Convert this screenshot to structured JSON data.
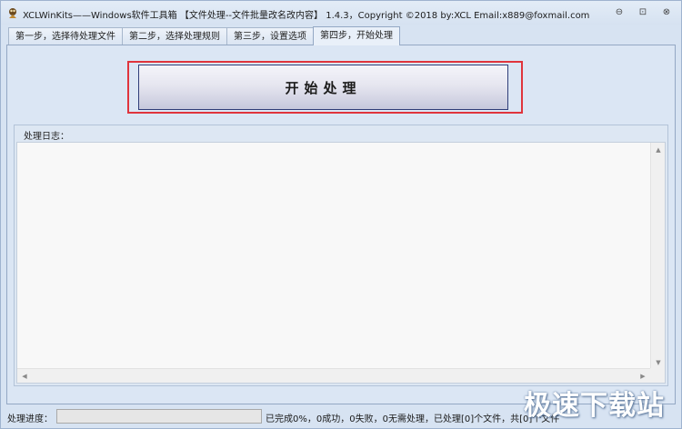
{
  "window": {
    "title": "XCLWinKits——Windows软件工具箱 【文件处理--文件批量改名改内容】 1.4.3，Copyright ©2018 by:XCL Email:x889@foxmail.com",
    "controls": {
      "minimize": "⊖",
      "maximize": "⊡",
      "close": "⊗"
    }
  },
  "tabs": [
    {
      "label": "第一步，选择待处理文件"
    },
    {
      "label": "第二步，选择处理规则"
    },
    {
      "label": "第三步，设置选项"
    },
    {
      "label": "第四步，开始处理",
      "active": true
    }
  ],
  "main": {
    "start_button_label": "开始处理",
    "log_label": "处理日志：",
    "log_content": ""
  },
  "status": {
    "progress_label": "处理进度：",
    "progress_value": 0,
    "summary": "已完成0%，0成功，0失败，0无需处理，已处理[0]个文件，共[0]个文件"
  },
  "watermark": "极速下载站",
  "colors": {
    "highlight": "#e0343c",
    "button_border": "#2f3d78",
    "progress_fill": "#06b025"
  }
}
